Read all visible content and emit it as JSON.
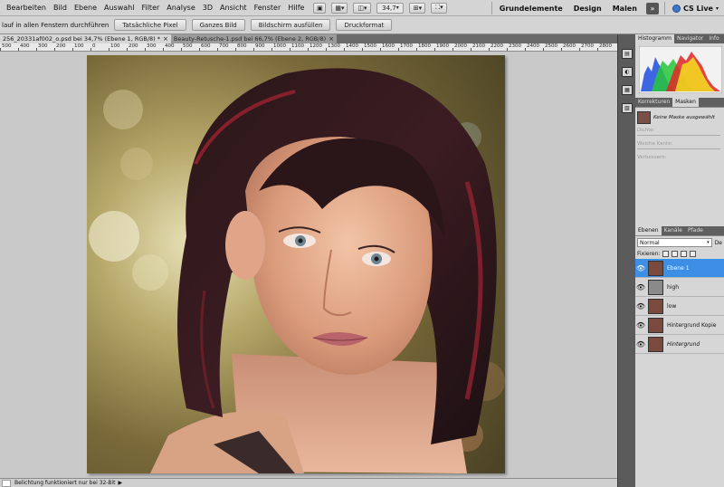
{
  "menubar": {
    "items": [
      "Bearbeiten",
      "Bild",
      "Ebene",
      "Auswahl",
      "Filter",
      "Analyse",
      "3D",
      "Ansicht",
      "Fenster",
      "Hilfe"
    ],
    "zoom_value": "34,7"
  },
  "workspaces": {
    "items": [
      "Grundelemente",
      "Design",
      "Malen"
    ],
    "more": "»",
    "cslive": "CS Live"
  },
  "options": {
    "checkbox_label": "lauf in allen Fenstern durchführen",
    "buttons": [
      "Tatsächliche Pixel",
      "Ganzes Bild",
      "Bildschirm ausfüllen",
      "Druckformat"
    ]
  },
  "doc_tabs": [
    {
      "label": "256_20331af002_o.psd bei 34,7% (Ebene 1, RGB/8) *",
      "active": true
    },
    {
      "label": "Beauty-Retusche-1.psd bei 66,7% (Ebene 2, RGB/8)",
      "active": false
    }
  ],
  "ruler": {
    "ticks": [
      "500",
      "400",
      "300",
      "200",
      "100",
      "0",
      "100",
      "200",
      "300",
      "400",
      "500",
      "600",
      "700",
      "800",
      "900",
      "1000",
      "1100",
      "1200",
      "1300",
      "1400",
      "1500",
      "1600",
      "1700",
      "1800",
      "1900",
      "2000",
      "2100",
      "2200",
      "2300",
      "2400",
      "2500",
      "2600",
      "2700",
      "2800"
    ]
  },
  "status": {
    "text": "Belichtung funktioniert nur bei 32-Bit"
  },
  "panels": {
    "top_tabs": [
      "Histogramm",
      "Navigator",
      "Info"
    ],
    "adj_tabs": [
      "Korrekturen",
      "Masken"
    ],
    "mask_info": "Keine Maske ausgewählt",
    "density_label": "Dichte:",
    "feather_label": "Weiche Kante:",
    "refine_label": "Verbessern:",
    "layers_tabs": [
      "Ebenen",
      "Kanäle",
      "Pfade"
    ],
    "blend_mode": "Normal",
    "blend_extra": "De",
    "lock_label": "Fixieren:",
    "layers": [
      {
        "name": "Ebene 1",
        "selected": true,
        "italic": false
      },
      {
        "name": "high",
        "selected": false,
        "italic": false
      },
      {
        "name": "low",
        "selected": false,
        "italic": false
      },
      {
        "name": "Hintergrund Kopie",
        "selected": false,
        "italic": false
      },
      {
        "name": "Hintergrund",
        "selected": false,
        "italic": true
      }
    ]
  },
  "colors": {
    "selection": "#3d8ee5",
    "canvas_bg": "#c9c9c9",
    "panel_bg": "#d6d6d6"
  }
}
